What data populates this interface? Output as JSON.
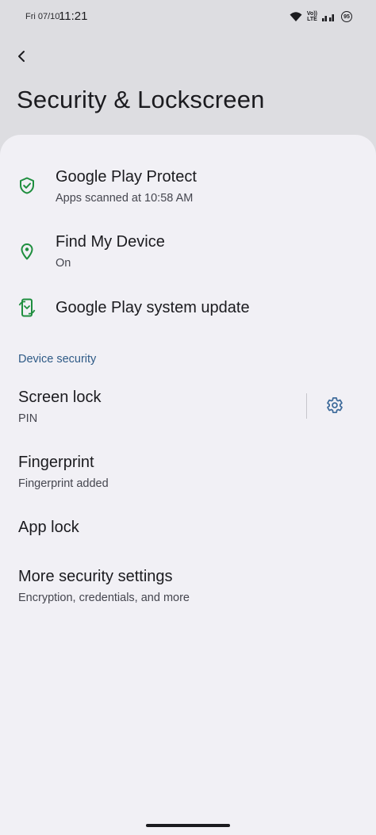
{
  "status_bar": {
    "date": "Fri 07/10",
    "time": "11:21",
    "network_top": "Vo))",
    "network_bottom": "LTE",
    "battery": "95"
  },
  "header": {
    "title": "Security & Lockscreen"
  },
  "items": {
    "play_protect": {
      "title": "Google Play Protect",
      "subtitle": "Apps scanned at 10:58 AM"
    },
    "find_device": {
      "title": "Find My Device",
      "subtitle": "On"
    },
    "system_update": {
      "title": "Google Play system update"
    }
  },
  "device_security": {
    "header": "Device security",
    "screen_lock": {
      "title": "Screen lock",
      "subtitle": "PIN"
    },
    "fingerprint": {
      "title": "Fingerprint",
      "subtitle": "Fingerprint added"
    },
    "app_lock": {
      "title": "App lock"
    },
    "more_settings": {
      "title": "More security settings",
      "subtitle": "Encryption, credentials, and more"
    }
  },
  "colors": {
    "accent_green": "#1e8e3e",
    "section_blue": "#2e5a86",
    "gear_blue": "#3d6a9a"
  }
}
